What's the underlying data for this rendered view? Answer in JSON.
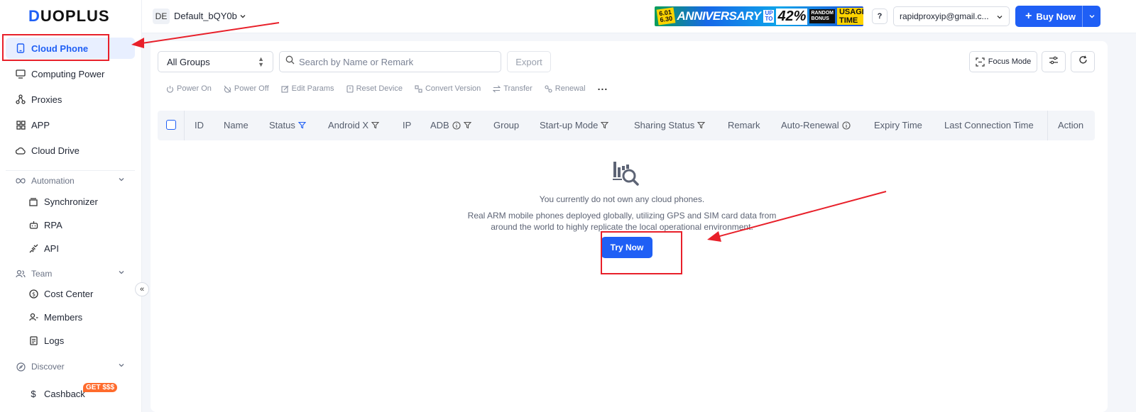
{
  "brand": {
    "logo_text": "DUOPLUS",
    "logo_first": "D",
    "logo_rest": "UOPLUS",
    "accent": "#1f5ff5"
  },
  "sidebar": {
    "items": [
      {
        "label": "Cloud Phone",
        "icon": "phone-icon",
        "active": true
      },
      {
        "label": "Computing Power",
        "icon": "monitor-icon"
      },
      {
        "label": "Proxies",
        "icon": "network-icon"
      },
      {
        "label": "APP",
        "icon": "grid-icon"
      },
      {
        "label": "Cloud Drive",
        "icon": "cloud-icon"
      }
    ],
    "sections": {
      "automation": {
        "label": "Automation",
        "items": [
          "Synchronizer",
          "RPA",
          "API"
        ]
      },
      "team": {
        "label": "Team",
        "items": [
          "Cost Center",
          "Members",
          "Logs"
        ]
      },
      "discover": {
        "label": "Discover",
        "items": [
          "Cashback"
        ]
      }
    },
    "cashback_badge": "GET $$$"
  },
  "header": {
    "workspace_avatar": "DE",
    "workspace_name": "Default_bQY0b",
    "promo": {
      "dates": "6.01 6.30",
      "title": "ANNIVERSARY",
      "upto": "UP TO",
      "percent": "42%",
      "off": "OFF",
      "bonus": "RANDOM BONUS",
      "usage": "USAGE TIME"
    },
    "help": "?",
    "account": "rapidproxyip@gmail.c...",
    "buy_label": "Buy Now"
  },
  "filters": {
    "group_select": "All Groups",
    "search_placeholder": "Search by Name or Remark",
    "export_label": "Export",
    "focus_mode_label": "Focus Mode"
  },
  "toolbar": [
    "Power On",
    "Power Off",
    "Edit Params",
    "Reset Device",
    "Convert Version",
    "Transfer",
    "Renewal"
  ],
  "table": {
    "columns": [
      "ID",
      "Name",
      "Status",
      "Android X",
      "IP",
      "ADB",
      "Group",
      "Start-up Mode",
      "Sharing Status",
      "Remark",
      "Auto-Renewal",
      "Expiry Time",
      "Last Connection Time",
      "Action"
    ]
  },
  "empty_state": {
    "title": "You currently do not own any cloud phones.",
    "description": "Real ARM mobile phones deployed globally, utilizing GPS and SIM card data from around the world to highly replicate the local operational environment.",
    "button": "Try Now"
  }
}
